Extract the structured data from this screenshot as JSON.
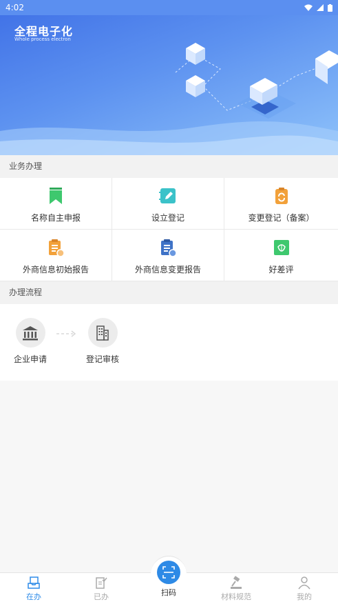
{
  "status_bar": {
    "time": "4:02"
  },
  "banner": {
    "title": "全程电子化",
    "subtitle": "Whole process electron"
  },
  "sections": {
    "business": "业务办理",
    "process": "办理流程"
  },
  "services": [
    {
      "label": "名称自主申报",
      "icon": "bookmark-icon",
      "color": "#3ec86e"
    },
    {
      "label": "设立登记",
      "icon": "notebook-edit-icon",
      "color": "#3bc2c9"
    },
    {
      "label": "变更登记（备案）",
      "icon": "clipboard-refresh-icon",
      "color": "#f2a13a"
    },
    {
      "label": "外商信息初始报告",
      "icon": "clipboard-report-icon",
      "color": "#f2a13a"
    },
    {
      "label": "外商信息变更报告",
      "icon": "clipboard-change-icon",
      "color": "#3f73c7"
    },
    {
      "label": "好差评",
      "icon": "lotus-rating-icon",
      "color": "#3ec86e"
    }
  ],
  "flow": [
    {
      "label": "企业申请",
      "icon": "bank-building-icon"
    },
    {
      "label": "登记审核",
      "icon": "office-building-icon"
    }
  ],
  "nav": {
    "items": [
      {
        "label": "在办",
        "icon": "inbox-icon",
        "active": true
      },
      {
        "label": "已办",
        "icon": "done-document-icon",
        "active": false
      },
      {
        "label": "材料规范",
        "icon": "gavel-icon",
        "active": false
      },
      {
        "label": "我的",
        "icon": "person-icon",
        "active": false
      }
    ],
    "scan_label": "扫码"
  },
  "colors": {
    "accent": "#2e8ae6",
    "banner": "#4f86ee"
  }
}
